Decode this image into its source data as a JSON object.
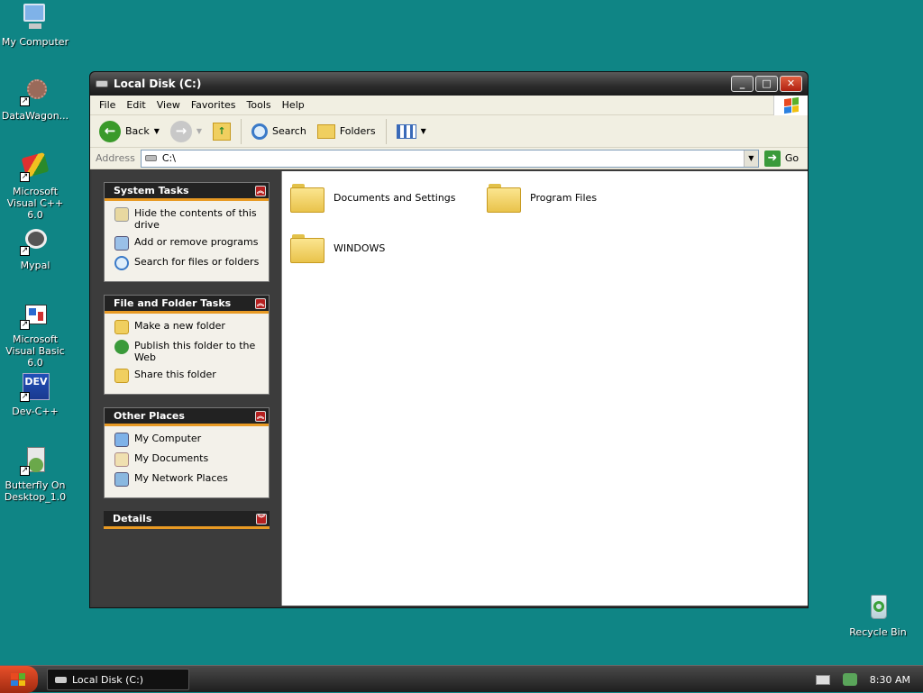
{
  "desktop": {
    "icons": [
      {
        "label": "My Computer",
        "icon": "my-computer-icon"
      },
      {
        "label": "DataWagon...",
        "icon": "datawagon-icon"
      },
      {
        "label": "Microsoft Visual C++ 6.0",
        "icon": "visual-cpp-icon"
      },
      {
        "label": "Mypal",
        "icon": "mypal-icon"
      },
      {
        "label": "Microsoft Visual Basic 6.0",
        "icon": "visual-basic-icon"
      },
      {
        "label": "Dev-C++",
        "icon": "dev-cpp-icon"
      },
      {
        "label": "Butterfly On Desktop_1.0",
        "icon": "butterfly-icon"
      },
      {
        "label": "Recycle Bin",
        "icon": "recycle-bin-icon"
      }
    ],
    "devcpp_icon_text": "DEV"
  },
  "window": {
    "title": "Local Disk (C:)",
    "menu": [
      "File",
      "Edit",
      "View",
      "Favorites",
      "Tools",
      "Help"
    ],
    "toolbar": {
      "back": "Back",
      "search": "Search",
      "folders": "Folders"
    },
    "address": {
      "label": "Address",
      "value": "C:\\",
      "go": "Go"
    }
  },
  "panels": {
    "system_tasks": {
      "title": "System Tasks",
      "items": [
        "Hide the contents of this drive",
        "Add or remove programs",
        "Search for files or folders"
      ]
    },
    "file_folder_tasks": {
      "title": "File and Folder Tasks",
      "items": [
        "Make a new folder",
        "Publish this folder to the Web",
        "Share this folder"
      ]
    },
    "other_places": {
      "title": "Other Places",
      "items": [
        "My Computer",
        "My Documents",
        "My Network Places"
      ]
    },
    "details": {
      "title": "Details"
    }
  },
  "folders": [
    "Documents and Settings",
    "Program Files",
    "WINDOWS"
  ],
  "taskbar": {
    "task": "Local Disk (C:)",
    "clock": "8:30 AM"
  },
  "colors": {
    "desktop": "#0f8585",
    "panel_accent": "#e89a24",
    "folder": "#f0cf5f"
  }
}
